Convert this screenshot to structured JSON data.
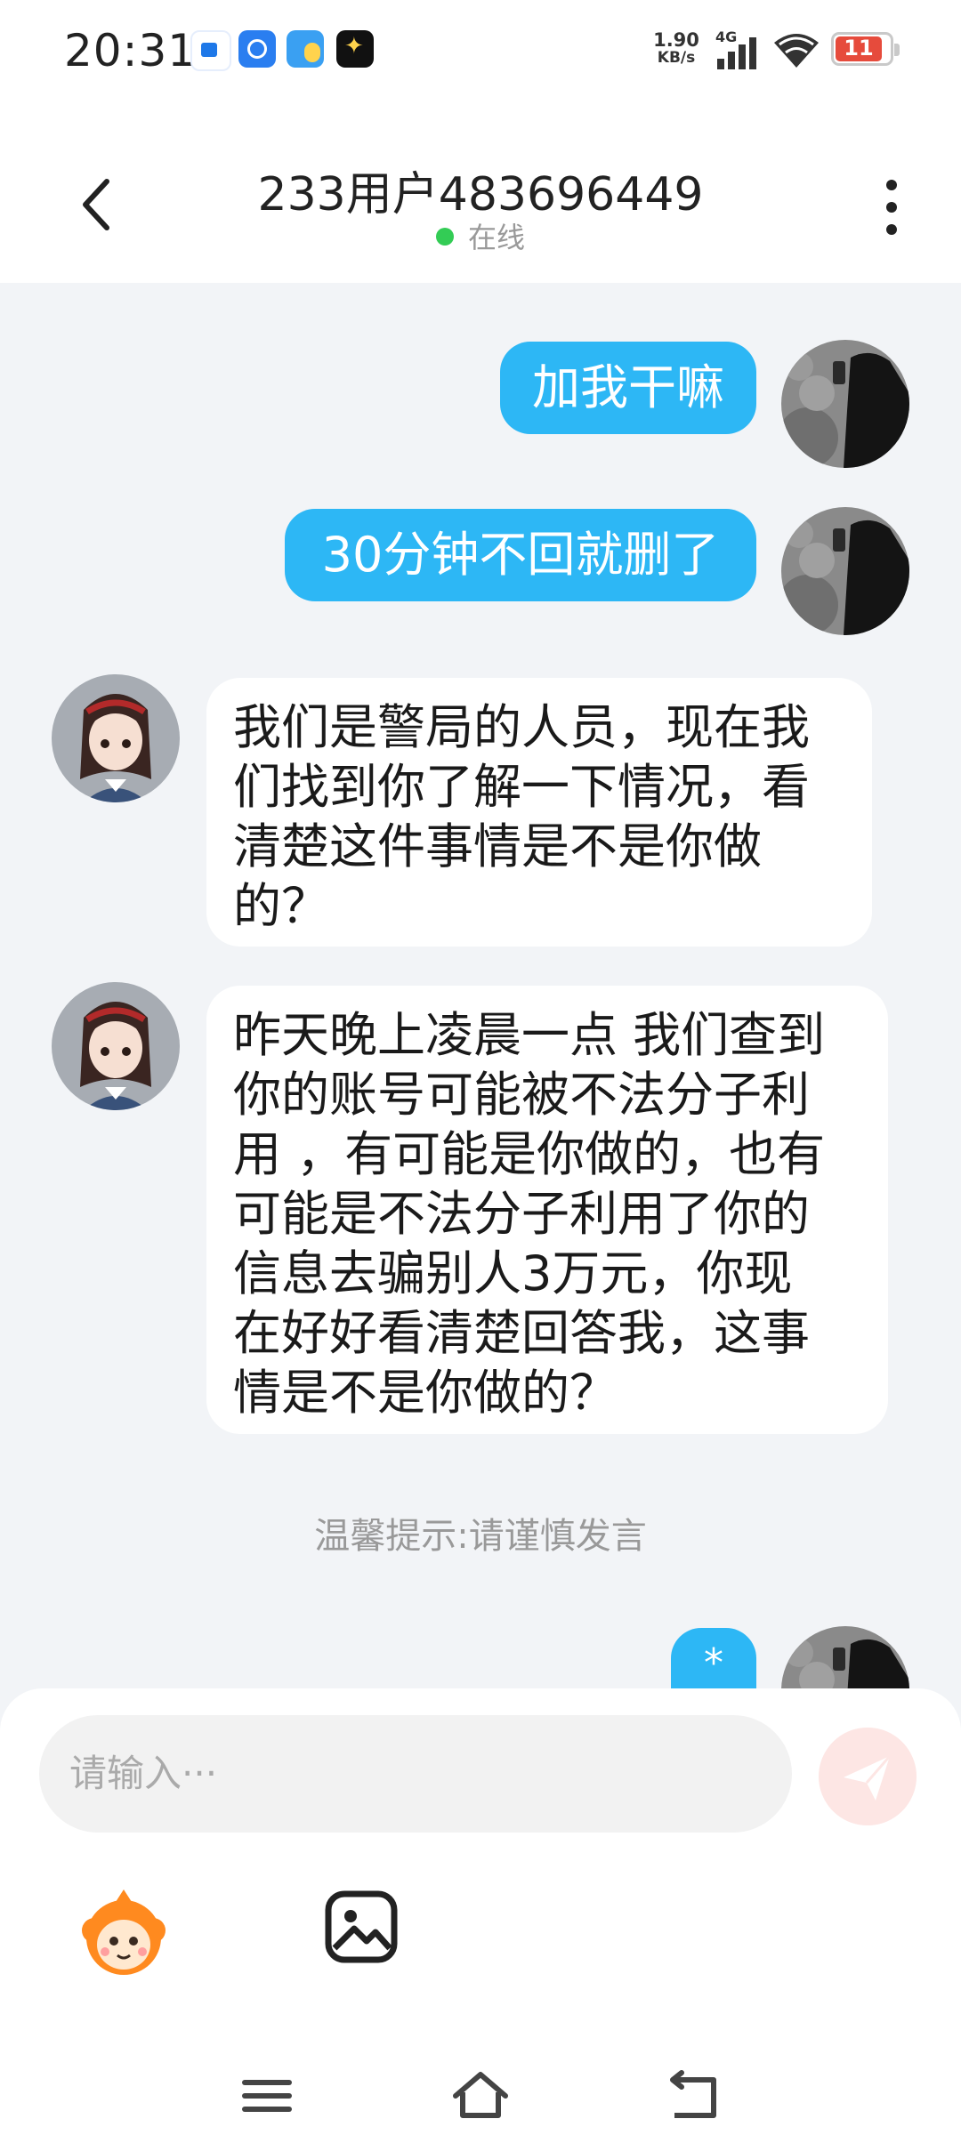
{
  "status_bar": {
    "time": "20:31",
    "net_speed_value": "1.90",
    "net_speed_unit": "KB/s",
    "network_type": "4G",
    "battery_level": "11"
  },
  "header": {
    "title": "233用户483696449",
    "status": "在线"
  },
  "messages": [
    {
      "direction": "out",
      "text": "加我干嘛"
    },
    {
      "direction": "out",
      "text": "30分钟不回就删了"
    },
    {
      "direction": "in",
      "lines": [
        "我们是警局的人员，现在我",
        "们找到你了解一下情况，看",
        "清楚这件事情是不是你做",
        "的？"
      ]
    },
    {
      "direction": "in",
      "lines": [
        "昨天晚上凌晨一点 我们查到",
        "你的账号可能被不法分子利",
        "用 ，有可能是你做的，也有",
        "可能是不法分子利用了你的",
        "信息去骗别人3万元，你现",
        "在好好看清楚回答我，这事",
        "情是不是你做的？"
      ]
    },
    {
      "direction": "out",
      "text": "*"
    }
  ],
  "tip": "温馨提示:请谨慎发言",
  "input": {
    "placeholder": "请输入···"
  },
  "colors": {
    "outgoing_bubble": "#2db7f5",
    "incoming_bubble": "#ffffff",
    "online_dot": "#33cc55",
    "send_button": "#fde6e4"
  },
  "icons": [
    "back-arrow-icon",
    "more-vertical-icon",
    "send-icon",
    "emoji-icon",
    "image-icon",
    "menu-nav-icon",
    "home-nav-icon",
    "back-nav-icon"
  ]
}
